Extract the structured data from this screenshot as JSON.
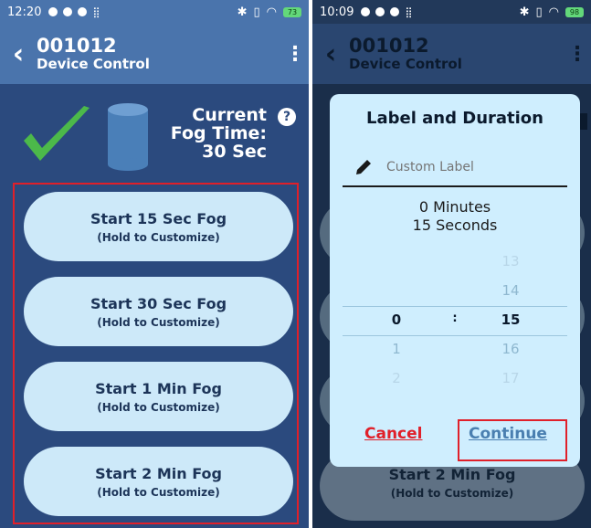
{
  "left": {
    "status": {
      "time": "12:20",
      "battery": "73"
    },
    "device_id": "001012",
    "screen_title": "Device Control",
    "fog_label_line1": "Current",
    "fog_label_line2": "Fog Time:",
    "fog_label_line3": "30 Sec",
    "help": "?",
    "buttons": [
      {
        "label": "Start 15 Sec Fog",
        "hint": "(Hold to Customize)"
      },
      {
        "label": "Start 30 Sec Fog",
        "hint": "(Hold to Customize)"
      },
      {
        "label": "Start 1 Min Fog",
        "hint": "(Hold to Customize)"
      },
      {
        "label": "Start 2 Min Fog",
        "hint": "(Hold to Customize)"
      }
    ]
  },
  "right": {
    "status": {
      "time": "10:09",
      "battery": "98"
    },
    "device_id": "001012",
    "screen_title": "Device Control",
    "dialog": {
      "title": "Label and Duration",
      "label_placeholder": "Custom Label",
      "minutes_text": "0 Minutes",
      "seconds_text": "15 Seconds",
      "picker_colon": ":",
      "minutes_col": [
        "",
        "",
        "0",
        "1",
        "2"
      ],
      "seconds_col": [
        "13",
        "14",
        "15",
        "16",
        "17"
      ],
      "cancel": "Cancel",
      "continue": "Continue"
    },
    "bg_button": {
      "label": "Start 2 Min Fog",
      "hint": "(Hold to Customize)"
    }
  },
  "colors": {
    "panel": "#2b4a7e",
    "appbar": "#4a74ac",
    "button": "#cde9f9",
    "check": "#4cb94a",
    "cylinder": "#4a7fb8",
    "highlight": "#e0202a",
    "dialog": "#cfeefe"
  }
}
